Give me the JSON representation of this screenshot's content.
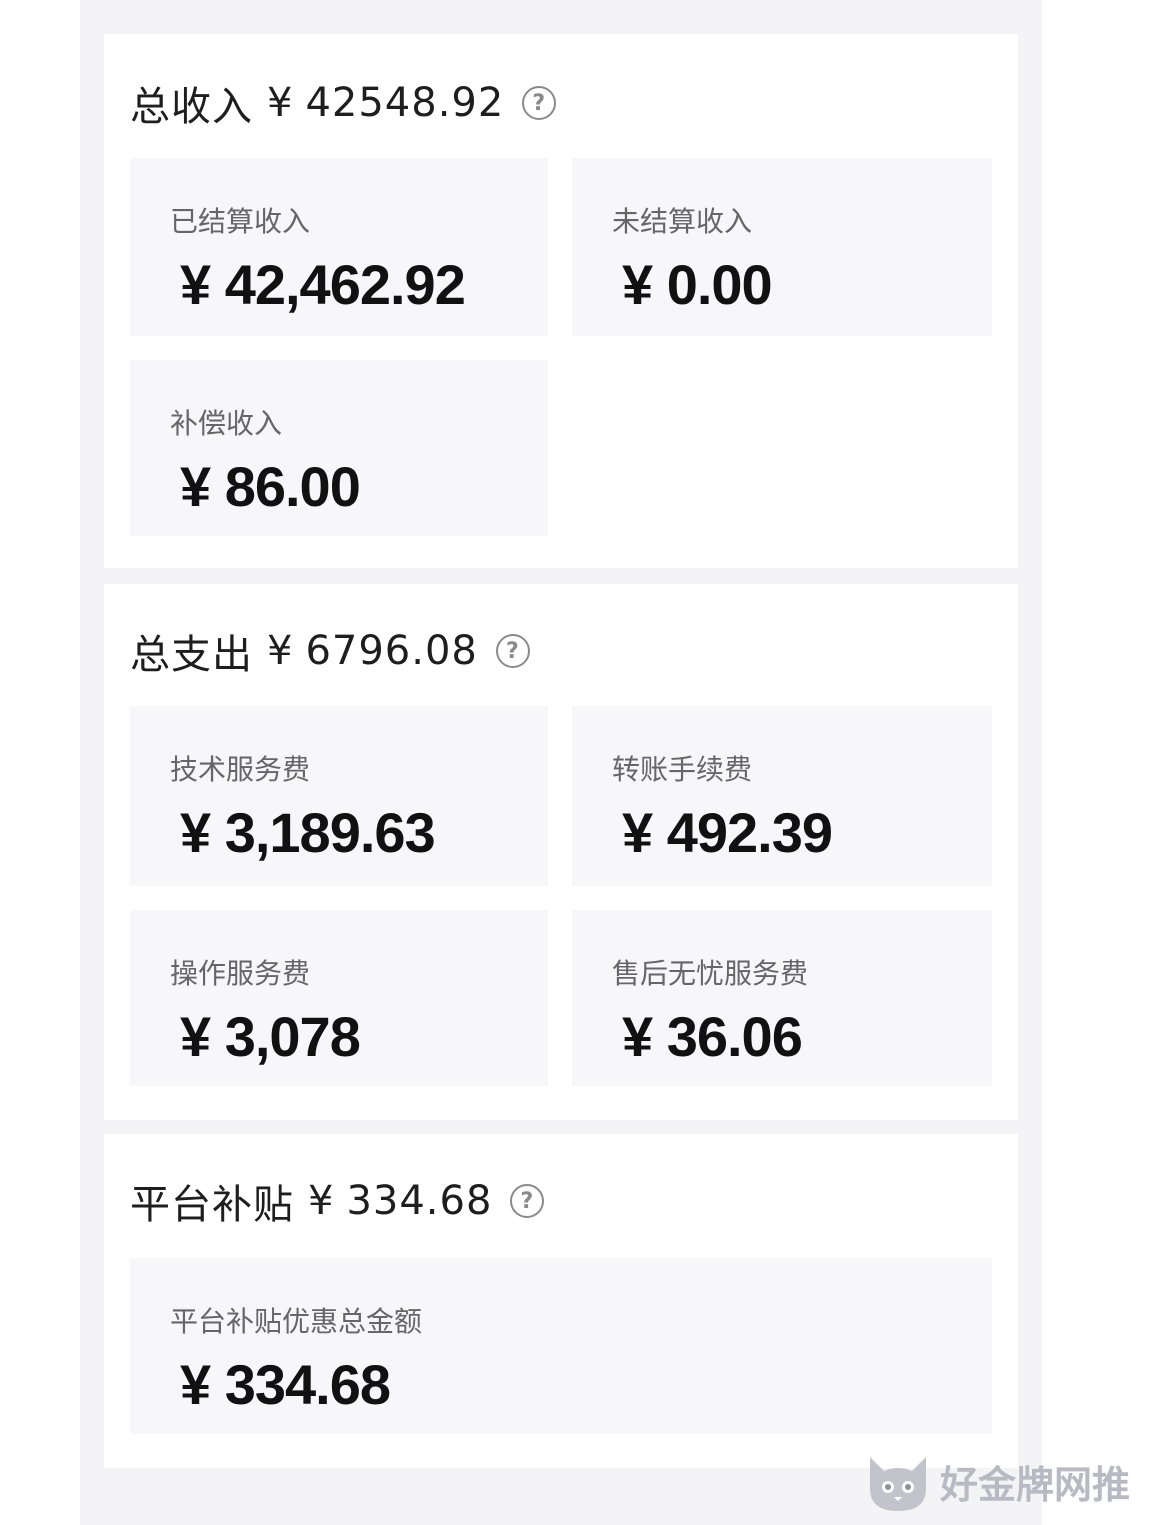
{
  "income": {
    "title": "总收入",
    "symbol": "¥",
    "amount": "42548.92",
    "help_icon": "question-circle-icon",
    "tiles": [
      {
        "label": "已结算收入",
        "value": "¥ 42,462.92"
      },
      {
        "label": "未结算收入",
        "value": "¥ 0.00"
      },
      {
        "label": "补偿收入",
        "value": "¥ 86.00"
      }
    ]
  },
  "expense": {
    "title": "总支出",
    "symbol": "¥",
    "amount": "6796.08",
    "help_icon": "question-circle-icon",
    "tiles": [
      {
        "label": "技术服务费",
        "value": "¥ 3,189.63"
      },
      {
        "label": "转账手续费",
        "value": "¥ 492.39"
      },
      {
        "label": "操作服务费",
        "value": "¥ 3,078"
      },
      {
        "label": "售后无忧服务费",
        "value": "¥ 36.06"
      }
    ]
  },
  "subsidy": {
    "title": "平台补贴",
    "symbol": "¥",
    "amount": "334.68",
    "help_icon": "question-circle-icon",
    "tiles": [
      {
        "label": "平台补贴优惠总金额",
        "value": "¥ 334.68"
      }
    ]
  },
  "watermark": {
    "text": "好金牌网推",
    "icon": "cat-logo-icon"
  },
  "colors": {
    "page_background": "#f4f4f6",
    "card_background": "#ffffff",
    "tile_background": "#f7f7f9",
    "label_text": "#666666",
    "value_text": "#111111"
  }
}
